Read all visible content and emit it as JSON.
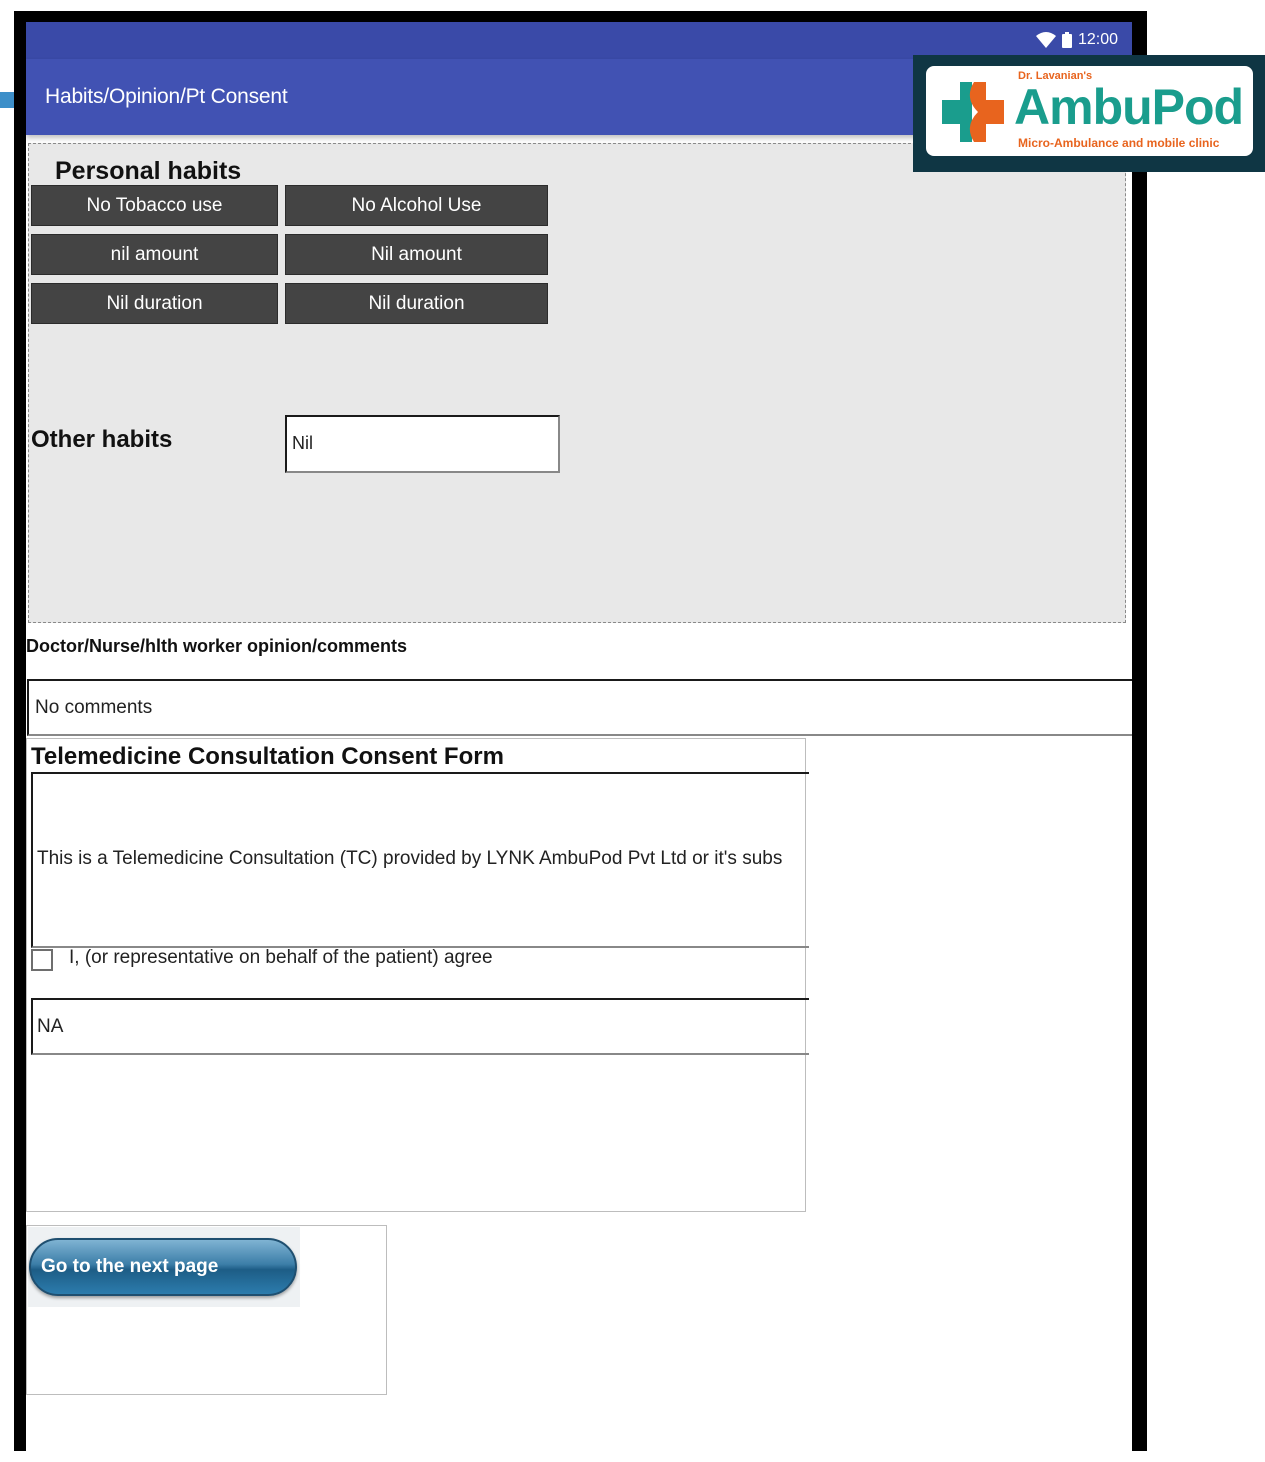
{
  "status_bar": {
    "time": "12:00",
    "wifi_icon": "wifi-icon",
    "battery_icon": "battery-icon"
  },
  "app_bar": {
    "title": "Habits/Opinion/Pt Consent"
  },
  "logo": {
    "subtitle": "Dr. Lavanian's",
    "name": "AmbuPod",
    "tagline": "Micro-Ambulance and mobile clinic",
    "colors": {
      "teal": "#1a9d8d",
      "orange": "#e8641e",
      "frame": "#0f3644"
    }
  },
  "personal_habits": {
    "title": "Personal habits",
    "buttons": [
      [
        "No Tobacco use",
        "No Alcohol Use"
      ],
      [
        "nil amount",
        "Nil amount"
      ],
      [
        "Nil duration",
        "Nil duration"
      ]
    ]
  },
  "other_habits": {
    "label": "Other habits",
    "value": "Nil"
  },
  "opinion": {
    "label": "Doctor/Nurse/hlth worker opinion/comments",
    "value": "No comments"
  },
  "consent": {
    "title": "Telemedicine Consultation Consent Form",
    "text": "This is a Telemedicine Consultation (TC) provided by LYNK AmbuPod Pvt Ltd or it's subs",
    "agree_label": "I, (or representative on behalf of the patient) agree",
    "agree_checked": false,
    "field_value": "NA"
  },
  "next_button": {
    "label": "Go to the next page"
  },
  "colors": {
    "app_bar": "#4152b3",
    "status_bar": "#3a4aa8",
    "habit_button": "#444444",
    "panel_bg": "#e8e8e8"
  }
}
